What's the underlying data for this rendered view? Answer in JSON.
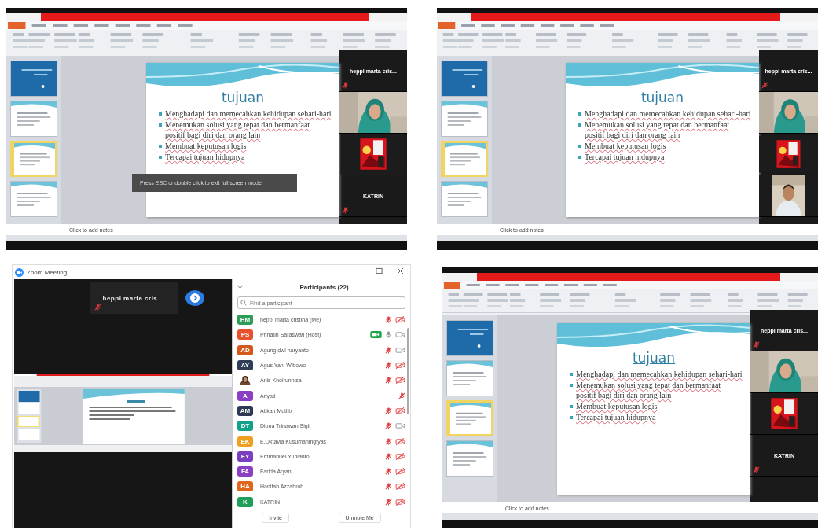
{
  "panels": [
    {
      "kind": "powerpoint",
      "fullscreen_hint": "Press ESC or double click to exit full screen mode",
      "slides": [
        {
          "kind": "title",
          "selected": false
        },
        {
          "kind": "content",
          "selected": false
        },
        {
          "kind": "content",
          "selected": true
        },
        {
          "kind": "content",
          "selected": false
        }
      ],
      "slide": {
        "title": "tujuan",
        "title_underlined": false,
        "bullets": [
          "Menghadapi dan memecahkan kehidupan sehari-hari",
          "Menemukan solusi yang tepat dan bermanfaat positif bagi diri dan orang lain",
          "Membuat keputusan logis",
          "Tercapai tujuan hidupnya"
        ]
      },
      "notes": {
        "placeholder": "Click to add notes"
      },
      "video_tiles": [
        {
          "kind": "name",
          "name": "heppi marta cris...",
          "mic_muted": true
        },
        {
          "kind": "video"
        },
        {
          "kind": "picture"
        },
        {
          "kind": "name",
          "name": "KATRIN",
          "mic_muted": true
        }
      ]
    },
    {
      "kind": "powerpoint",
      "slides": [
        {
          "kind": "title",
          "selected": false
        },
        {
          "kind": "content",
          "selected": false
        },
        {
          "kind": "content",
          "selected": true
        },
        {
          "kind": "content",
          "selected": false
        }
      ],
      "slide": {
        "title": "tujuan",
        "title_underlined": false,
        "bullets": [
          "Menghadapi dan memecahkan kehidupan sehari-hari",
          "Menemukan solusi yang tepat dan bermanfaat positif bagi diri dan orang lain",
          "Membuat keputusan logis",
          "Tercapai tujuan hidupnya"
        ]
      },
      "notes": {
        "placeholder": "Click to add notes"
      },
      "video_tiles": [
        {
          "kind": "name",
          "name": "heppi marta cris...",
          "mic_muted": true
        },
        {
          "kind": "video"
        },
        {
          "kind": "picture"
        },
        {
          "kind": "video"
        }
      ]
    },
    {
      "kind": "zoom",
      "window": {
        "title": "Zoom Meeting"
      },
      "speaker_tile": {
        "name": "heppi marta cris...",
        "mic_muted": true
      },
      "participants_panel": {
        "title": "Participants (22)",
        "search": {
          "placeholder": "Find a participant"
        },
        "participants": [
          {
            "kind": "initials",
            "initials": "HM",
            "color": "#2e9d5a",
            "name": "heppi marta cristina (Me)",
            "sharing": false,
            "audio_muted": true,
            "video_off": true
          },
          {
            "kind": "initials",
            "initials": "PS",
            "color": "#e8502c",
            "name": "Prihatin Saraswati (Host)",
            "sharing": true,
            "audio_muted": false,
            "video_off": false
          },
          {
            "kind": "initials",
            "initials": "AD",
            "color": "#d4581b",
            "name": "Agung dwi haryanto",
            "sharing": false,
            "audio_muted": true,
            "video_off": false
          },
          {
            "kind": "initials",
            "initials": "AY",
            "color": "#2f3d57",
            "name": "Agus Yani Wibowo",
            "sharing": false,
            "audio_muted": true,
            "video_off": true
          },
          {
            "name": "Anis Khoirunnisa",
            "sharing": false,
            "audio_muted": true,
            "video_off": true
          },
          {
            "kind": "initials",
            "initials": "A",
            "color": "#8a3ec4",
            "name": "Ariyati",
            "sharing": false,
            "audio_muted": true
          },
          {
            "kind": "initials",
            "initials": "AM",
            "color": "#2c3a54",
            "name": "Atikah Mutlib",
            "sharing": false,
            "audio_muted": true,
            "video_off": true
          },
          {
            "kind": "initials",
            "initials": "DT",
            "color": "#14a08a",
            "name": "Diona Trinawan Sigit",
            "sharing": false,
            "audio_muted": true,
            "video_off": false
          },
          {
            "kind": "initials",
            "initials": "EK",
            "color": "#f0a020",
            "name": "E.Oktavia Kusumaningtyas",
            "sharing": false,
            "audio_muted": true,
            "video_off": true
          },
          {
            "kind": "initials",
            "initials": "EY",
            "color": "#7b3ec1",
            "name": "Emmanuel Yunianto",
            "sharing": false,
            "audio_muted": true,
            "video_off": true
          },
          {
            "kind": "initials",
            "initials": "FA",
            "color": "#8b3fc4",
            "name": "Farida Aryani",
            "sharing": false,
            "audio_muted": true,
            "video_off": true
          },
          {
            "kind": "initials",
            "initials": "HA",
            "color": "#e0661b",
            "name": "Hanifah Azzahroh",
            "sharing": false,
            "audio_muted": true,
            "video_off": true
          },
          {
            "kind": "initials",
            "initials": "K",
            "color": "#1f9d5b",
            "name": "KATRIN",
            "sharing": false,
            "audio_muted": true,
            "video_off": true
          }
        ],
        "buttons": [
          "Invite",
          "Unmute Me"
        ]
      }
    },
    {
      "kind": "powerpoint",
      "slides": [
        {
          "kind": "title",
          "selected": false
        },
        {
          "kind": "content",
          "selected": false
        },
        {
          "kind": "content",
          "selected": true
        },
        {
          "kind": "content",
          "selected": false
        }
      ],
      "slide": {
        "title": "tujuan",
        "title_underlined": true,
        "bullets": [
          "Menghadapi dan memecahkan kehidupan sehari-hari",
          "Menemukan solusi yang tepat dan bermanfaat positif bagi diri dan orang lain",
          "Membuat keputusan logis",
          "Tercapai tujuan hidupnya"
        ]
      },
      "notes": {
        "placeholder": "Click to add notes"
      },
      "video_tiles": [
        {
          "kind": "name",
          "name": "heppi marta cris...",
          "mic_muted": true
        },
        {
          "kind": "video"
        },
        {
          "kind": "picture"
        },
        {
          "kind": "name",
          "name": "KATRIN",
          "mic_muted": true
        }
      ]
    }
  ]
}
